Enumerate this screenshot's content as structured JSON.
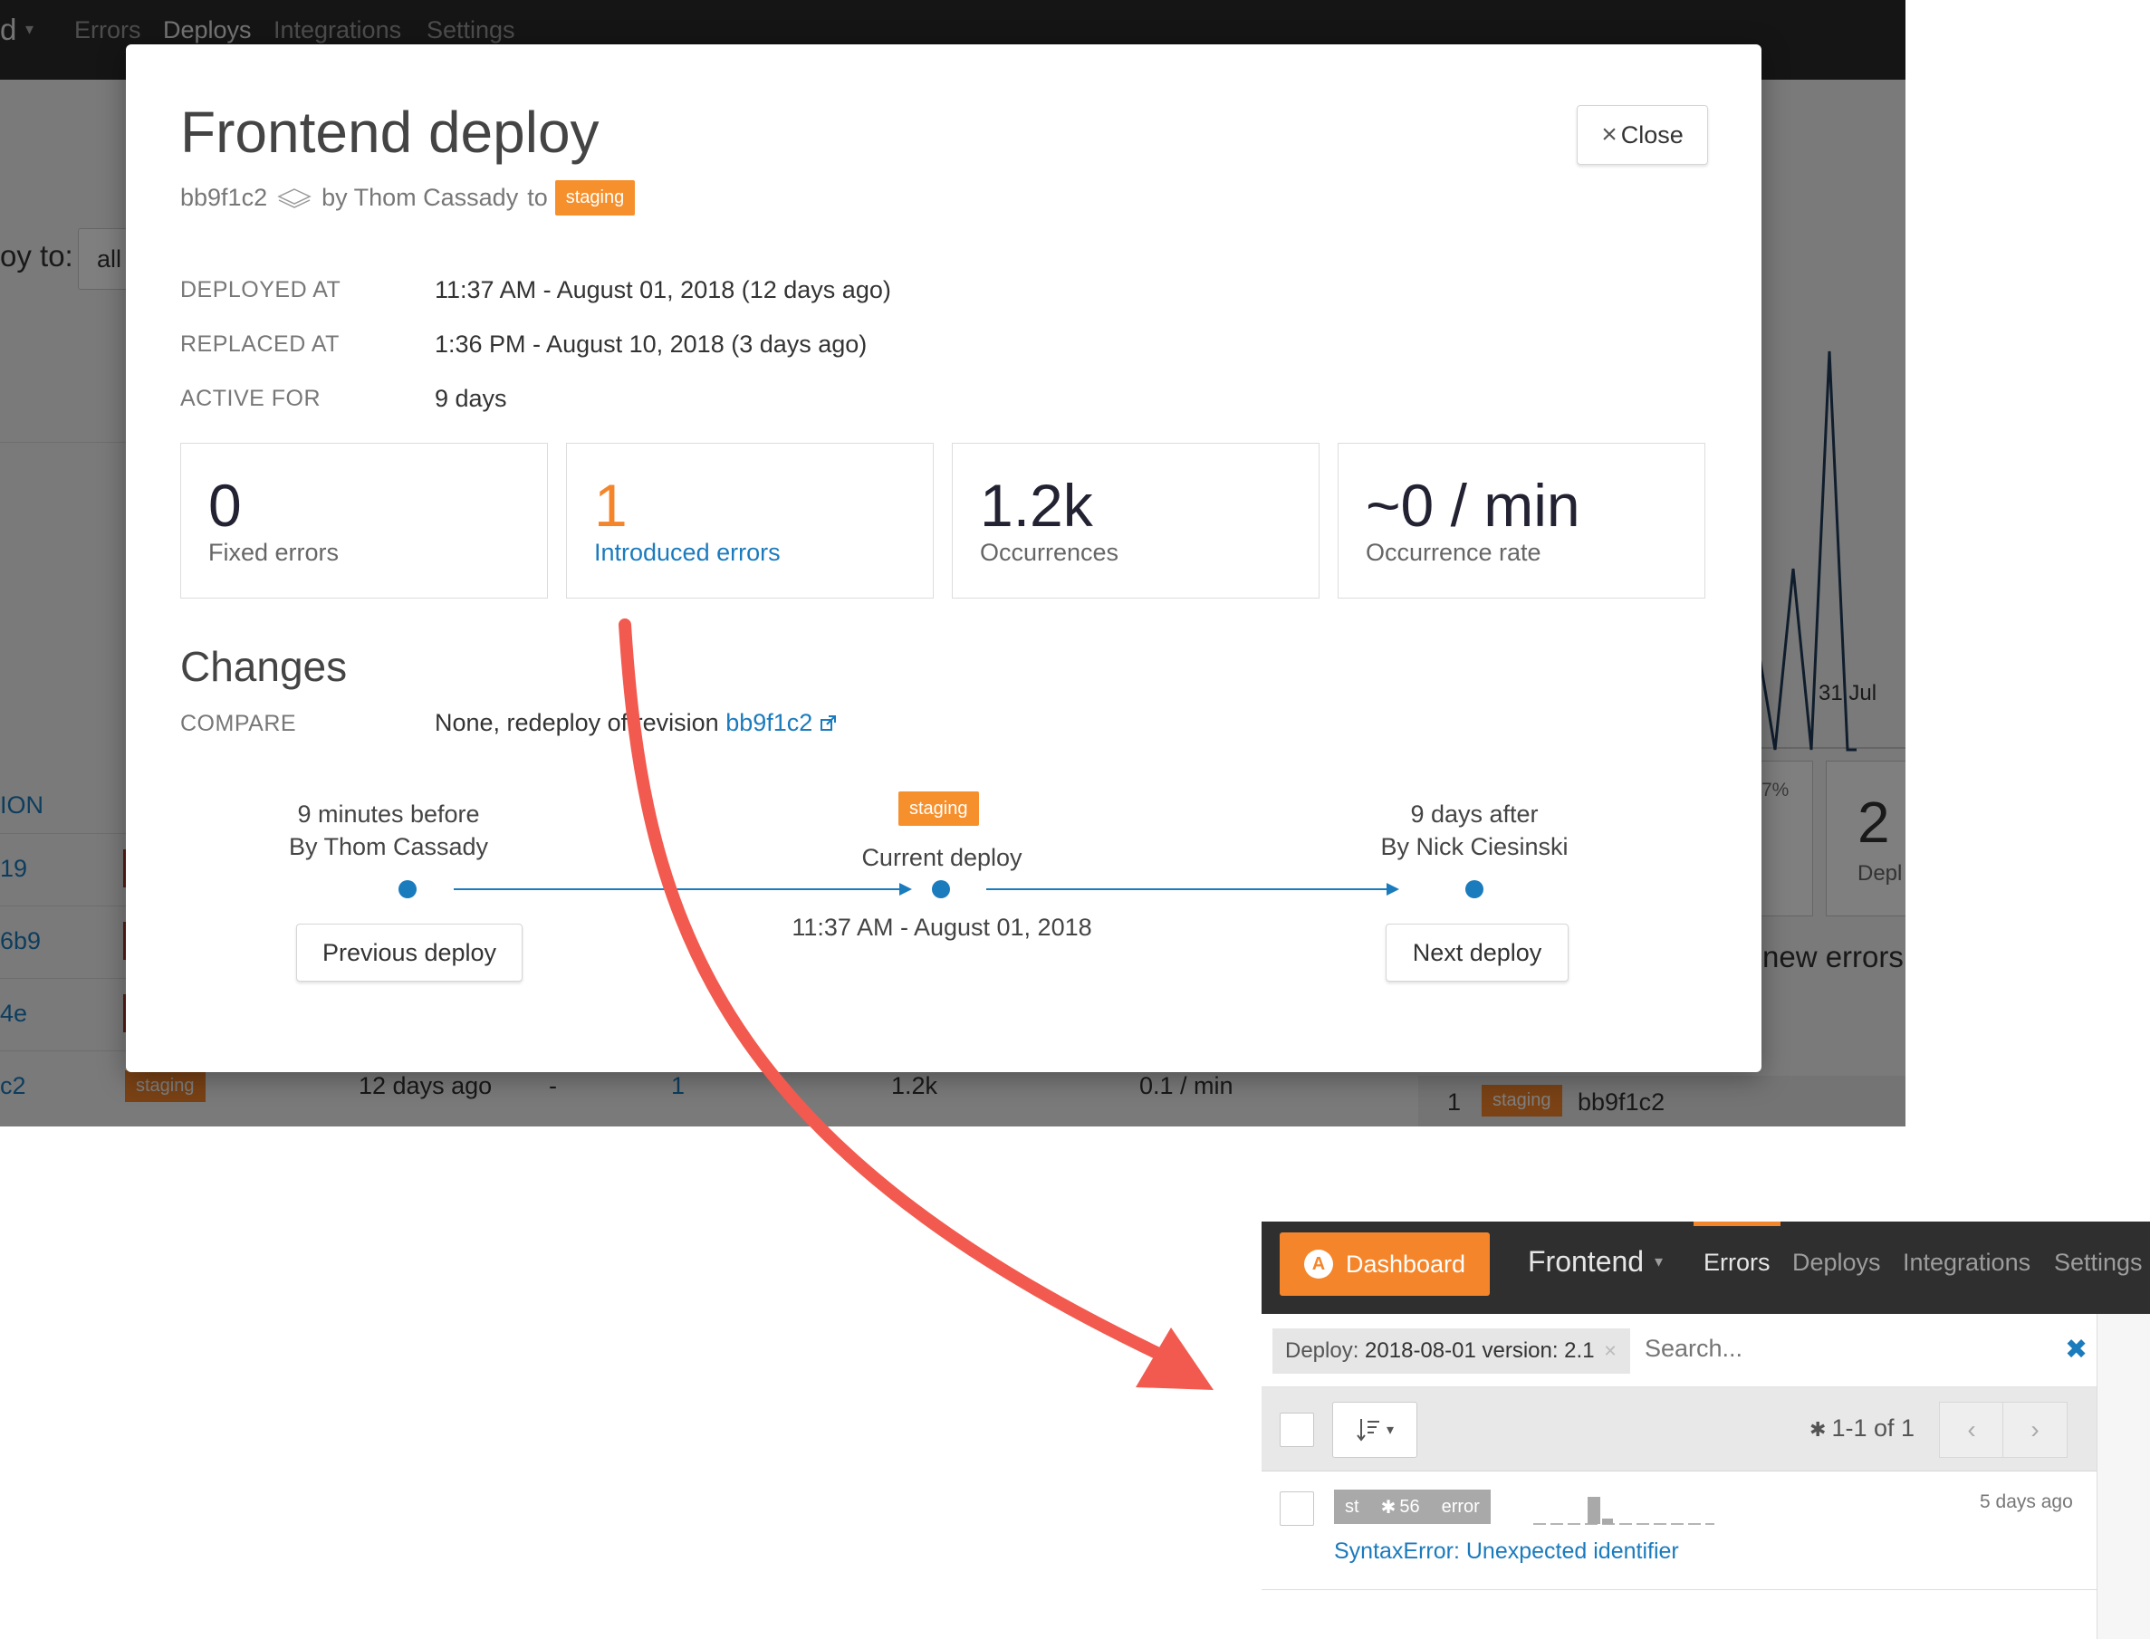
{
  "background_app": {
    "brand": "d",
    "nav": [
      "Errors",
      "Deploys",
      "Integrations",
      "Settings"
    ],
    "deploy_to_label": "oy to:",
    "deploy_to_value": "all",
    "column_header_partial": "ION",
    "rows": [
      {
        "rev": "19"
      },
      {
        "rev": "6b9"
      },
      {
        "rev": "4e"
      },
      {
        "rev": "c2",
        "env": "staging",
        "time": "12 days ago",
        "fixed": "-",
        "introduced": "1",
        "occurrences": "1.2k",
        "rate": "0.1 / min"
      }
    ],
    "chart_label": "31 Jul",
    "side_stat_percent": "7%",
    "side_stat_value": "2",
    "side_stat_label": "Depl",
    "new_errors_label": "new errors",
    "side_row": {
      "num": "1",
      "env": "staging",
      "rev": "bb9f1c2"
    }
  },
  "modal": {
    "title": "Frontend deploy",
    "close_label": "Close",
    "revision": "bb9f1c2",
    "by_text": "by Thom Cassady",
    "to_text": "to",
    "environment": "staging",
    "meta": [
      {
        "label": "DEPLOYED AT",
        "value": "11:37 AM - August 01, 2018 (12 days ago)"
      },
      {
        "label": "REPLACED AT",
        "value": "1:36 PM - August 10, 2018 (3 days ago)"
      },
      {
        "label": "ACTIVE FOR",
        "value": "9 days"
      }
    ],
    "stats": [
      {
        "value": "0",
        "label": "Fixed errors"
      },
      {
        "value": "1",
        "label": "Introduced errors"
      },
      {
        "value": "1.2k",
        "label": "Occurrences"
      },
      {
        "value": "~0 / min",
        "label": "Occurrence rate"
      }
    ],
    "changes_title": "Changes",
    "compare_label": "COMPARE",
    "compare_text": "None, redeploy of revision",
    "compare_link": "bb9f1c2",
    "timeline": {
      "previous": {
        "line1": "9 minutes before",
        "line2": "By Thom Cassady",
        "button": "Previous deploy"
      },
      "current": {
        "badge": "staging",
        "label": "Current deploy",
        "time": "11:37 AM - August 01, 2018"
      },
      "next": {
        "line1": "9 days after",
        "line2": "By Nick Ciesinski",
        "button": "Next deploy"
      }
    }
  },
  "inset": {
    "dashboard_label": "Dashboard",
    "project": "Frontend",
    "nav": [
      "Errors",
      "Deploys",
      "Integrations",
      "Settings"
    ],
    "filter_prefix": "Deploy:",
    "filter_value": "2018-08-01 version: 2.1",
    "search_placeholder": "Search...",
    "count": "1-1 of 1",
    "error": {
      "tag1": "st",
      "count": "56",
      "tag2": "error",
      "title": "SyntaxError: Unexpected identifier",
      "time": "5 days ago"
    }
  },
  "colors": {
    "accent": "#f4852b",
    "link": "#1a7bbd",
    "arrow": "#f25a4f"
  }
}
